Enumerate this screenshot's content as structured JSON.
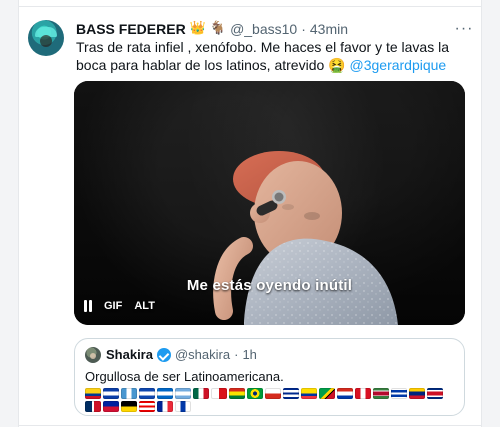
{
  "tweet": {
    "author_name": "BASS FEDERER",
    "author_handle": "@_bass10",
    "separator": "·",
    "timestamp": "43min",
    "emojis": [
      "👑",
      "🐐"
    ],
    "text_parts": [
      "Tras de rata infiel , xenófobo. Me haces el favor y te lavas la boca para hablar de los latinos, atrevido ",
      "🤮",
      " ",
      "@3gerardpique"
    ],
    "more_label": "···"
  },
  "media": {
    "caption": "Me estás oyendo inútil",
    "controls": {
      "gif_label": "GIF",
      "alt_label": "ALT"
    }
  },
  "quoted_tweet": {
    "author_name": "Shakira",
    "author_handle": "@shakira",
    "separator": "·",
    "timestamp": "1h",
    "text": "Orgullosa de ser Latinoamericana.",
    "flag_emojis": [
      "🇨🇴",
      "🇭🇳",
      "🇬🇹",
      "🇸🇻",
      "🇳🇮",
      "🇦🇷",
      "🇲🇽",
      "🇵🇦",
      "🇧🇴",
      "🇧🇷",
      "🇨🇱",
      "🇨🇺",
      "🇪🇨",
      "🇬🇾",
      "🇵🇾",
      "🇵🇪",
      "🇸🇷",
      "🇺🇾",
      "🇻🇪",
      "🇨🇷",
      "🇩🇴",
      "🇭🇹",
      "🇬🇵",
      "🇵🇷",
      "🇲🇶",
      "🇬🇫"
    ]
  },
  "colors": {
    "text_primary": "#0f1419",
    "text_secondary": "#536471",
    "link": "#1d9bf0",
    "border": "#cfd9de",
    "verified": "#1d9bf0"
  }
}
